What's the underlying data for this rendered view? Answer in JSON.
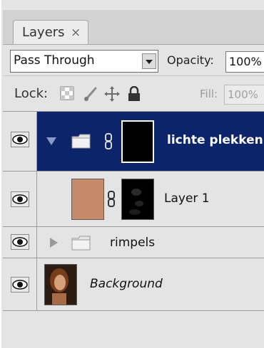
{
  "panel": {
    "tab_label": "Layers",
    "tab_close": "×",
    "blend_mode": "Pass Through",
    "opacity_label": "Opacity:",
    "opacity_value": "100%",
    "lock_label": "Lock:",
    "fill_label": "Fill:",
    "fill_value": "100%"
  },
  "layers": [
    {
      "name": "lichte plekken",
      "type": "group",
      "expanded": true,
      "selected": true,
      "visible": true,
      "has_mask": true
    },
    {
      "name": "Layer 1",
      "type": "layer",
      "selected": false,
      "visible": true,
      "has_mask": true,
      "thumb_color": "#c48a6a"
    },
    {
      "name": "rimpels",
      "type": "group",
      "expanded": false,
      "selected": false,
      "visible": true
    },
    {
      "name": "Background",
      "type": "background",
      "selected": false,
      "visible": true,
      "italic": true
    }
  ],
  "colors": {
    "selection": "#0b246a",
    "panel_bg": "#e4e4e4"
  }
}
